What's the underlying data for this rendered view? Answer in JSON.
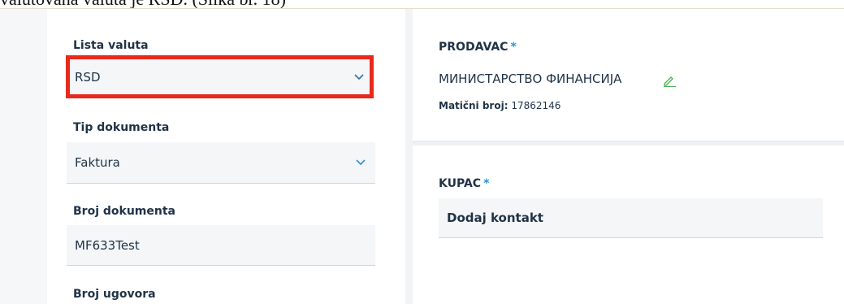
{
  "caption": {
    "text": "valutovana valuta je RSD. (Slika br. 18)"
  },
  "form": {
    "currency": {
      "label": "Lista valuta",
      "value": "RSD"
    },
    "doc_type": {
      "label": "Tip dokumenta",
      "value": "Faktura"
    },
    "doc_number": {
      "label": "Broj dokumenta",
      "value": "MF633Test"
    },
    "contract_number": {
      "label": "Broj ugovora"
    }
  },
  "seller": {
    "title": "PRODAVAC",
    "required_mark": "*",
    "name": "МИНИСТАРСТВО ФИНАНСИЈА",
    "reg_label": "Matični broj:",
    "reg_value": "17862146"
  },
  "buyer": {
    "title": "KUPAC",
    "required_mark": "*",
    "add_contact": "Dodaj kontakt"
  },
  "colors": {
    "highlight": "#e8291c",
    "accent": "#2f8fd6",
    "text": "#1f3347",
    "field_bg": "#f4f6f8"
  },
  "icons": [
    "chevron-down-icon",
    "pencil-icon"
  ]
}
